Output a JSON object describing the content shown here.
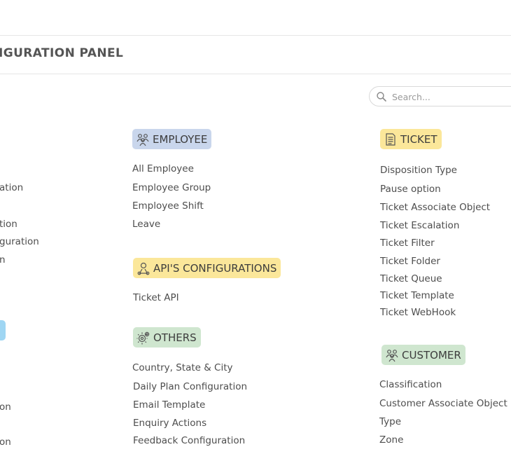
{
  "header": {
    "title": "IGURATION PANEL"
  },
  "search": {
    "placeholder": "Search..."
  },
  "left_column": {
    "items": [
      "ation",
      "tion",
      "guration",
      "n",
      "on",
      "on"
    ]
  },
  "employee": {
    "title": "EMPLOYEE",
    "icon": "people-icon",
    "items": [
      "All Employee",
      "Employee Group",
      "Employee Shift",
      "Leave"
    ]
  },
  "api": {
    "title": "API'S CONFIGURATIONS",
    "icon": "api-icon",
    "items": [
      "Ticket API"
    ]
  },
  "others": {
    "title": "OTHERS",
    "icon": "gears-icon",
    "items": [
      "Country, State & City",
      "Daily Plan Configuration",
      "Email Template",
      "Enquiry Actions",
      "Feedback Configuration"
    ]
  },
  "ticket": {
    "title": "TICKET",
    "icon": "document-icon",
    "items": [
      "Disposition Type",
      "Pause option",
      "Ticket Associate Object",
      "Ticket Escalation",
      "Ticket Filter",
      "Ticket Folder",
      "Ticket Queue",
      "Ticket Template",
      "Ticket WebHook"
    ]
  },
  "customer": {
    "title": "CUSTOMER",
    "icon": "people-icon",
    "items": [
      "Classification",
      "Customer Associate Object",
      "Type",
      "Zone"
    ]
  },
  "colors": {
    "employee_badge": "#c9d6ec",
    "api_badge": "#fbe79a",
    "others_badge": "#cfe6cf",
    "ticket_badge": "#fbe79a",
    "customer_badge": "#cfe6cf",
    "left_badge": "#9fd6f3"
  }
}
